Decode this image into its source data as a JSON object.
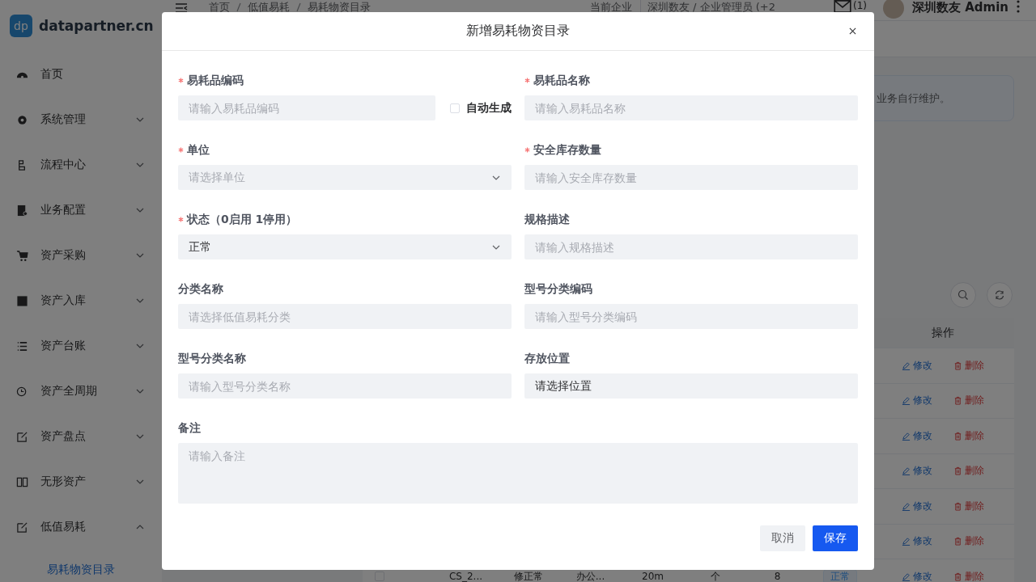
{
  "sidebar": {
    "logo": {
      "mark": "dp",
      "text": "datapartner.cn"
    },
    "items": [
      {
        "label": "首页"
      },
      {
        "label": "系统管理",
        "expanded": false
      },
      {
        "label": "流程中心",
        "expanded": false
      },
      {
        "label": "业务配置",
        "expanded": false
      },
      {
        "label": "资产采购",
        "expanded": false
      },
      {
        "label": "资产入库",
        "expanded": false
      },
      {
        "label": "资产台账",
        "expanded": false
      },
      {
        "label": "资产全周期",
        "expanded": false
      },
      {
        "label": "资产盘点",
        "expanded": false
      },
      {
        "label": "无形资产",
        "expanded": false
      },
      {
        "label": "低值易耗",
        "expanded": true,
        "children": [
          {
            "label": "易耗物资目录",
            "selected": true
          }
        ]
      }
    ]
  },
  "header": {
    "breadcrumb": [
      "首页",
      "低值易耗",
      "易耗物资目录"
    ],
    "company_label": "当前企业",
    "company": "深圳数友 / 企业管理员 (+2",
    "mail_count": "(1)",
    "user": "深圳数友 Admin"
  },
  "notice": {
    "text": "业务自行维护。"
  },
  "table": {
    "columns": [
      "操作"
    ],
    "rows": [
      {
        "actions": [
          "修改",
          "删除"
        ]
      },
      {
        "actions": [
          "修改",
          "删除"
        ]
      },
      {
        "actions": [
          "修改",
          "删除"
        ]
      },
      {
        "actions": [
          "修改",
          "删除"
        ]
      },
      {
        "actions": [
          "修改",
          "删除"
        ]
      },
      {
        "actions": [
          "修改",
          "删除"
        ]
      },
      {
        "checked": false,
        "cells": [
          "CS_2...",
          "修正常",
          "办公...",
          "20m",
          "个",
          "8"
        ],
        "status": "正常",
        "actions": [
          "修改",
          "删除"
        ]
      }
    ]
  },
  "dialog": {
    "title": "新增易耗物资目录",
    "fields": [
      {
        "kind": "input",
        "label": "易耗品编码",
        "required": true,
        "placeholder": "请输入易耗品编码",
        "auto_generate": {
          "label": "自动生成",
          "checked": false
        }
      },
      {
        "kind": "input",
        "label": "易耗品名称",
        "required": true,
        "placeholder": "请输入易耗品名称"
      },
      {
        "kind": "select",
        "label": "单位",
        "required": true,
        "placeholder": "请选择单位"
      },
      {
        "kind": "input",
        "label": "安全库存数量",
        "required": true,
        "placeholder": "请输入安全库存数量"
      },
      {
        "kind": "select",
        "label": "状态（0启用 1停用）",
        "required": true,
        "value": "正常"
      },
      {
        "kind": "input",
        "label": "规格描述",
        "required": false,
        "placeholder": "请输入规格描述"
      },
      {
        "kind": "input",
        "label": "分类名称",
        "required": false,
        "placeholder": "请选择低值易耗分类"
      },
      {
        "kind": "input",
        "label": "型号分类编码",
        "required": false,
        "placeholder": "请输入型号分类编码"
      },
      {
        "kind": "input",
        "label": "型号分类名称",
        "required": false,
        "placeholder": "请输入型号分类名称"
      },
      {
        "kind": "input",
        "label": "存放位置",
        "required": false,
        "value": "请选择位置"
      },
      {
        "kind": "textarea",
        "label": "备注",
        "required": false,
        "placeholder": "请输入备注"
      }
    ],
    "buttons": [
      {
        "label": "取消",
        "kind": "secondary"
      },
      {
        "label": "保存",
        "kind": "primary"
      }
    ]
  }
}
